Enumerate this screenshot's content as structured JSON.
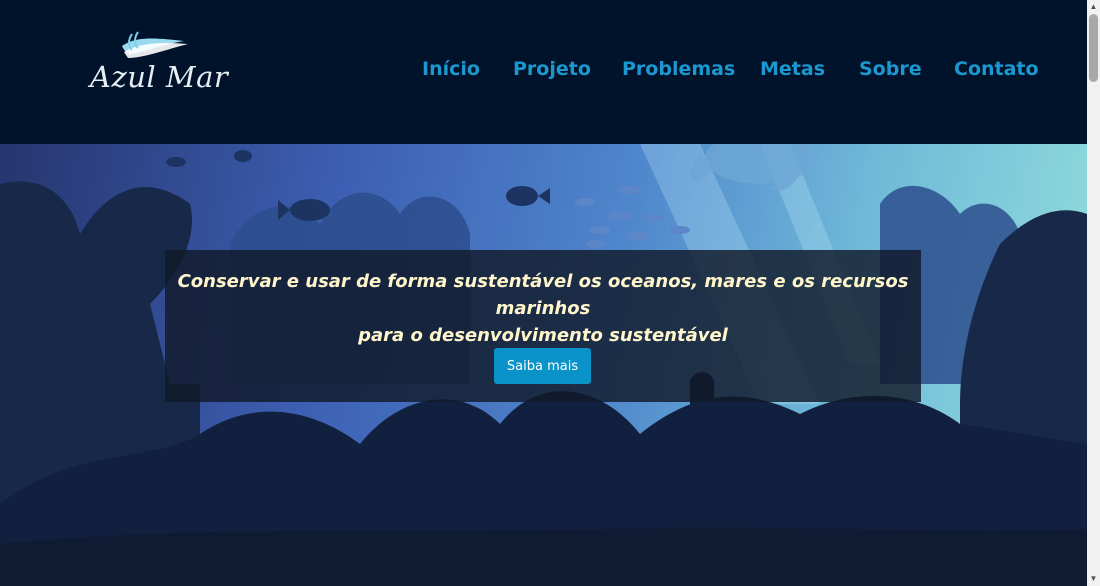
{
  "brand": {
    "name": "Azul Mar",
    "logo_icon": "wave-icon"
  },
  "nav": {
    "items": [
      {
        "label": "Início",
        "id": "inicio"
      },
      {
        "label": "Projeto",
        "id": "projeto"
      },
      {
        "label": "Problemas",
        "id": "problemas"
      },
      {
        "label": "Metas",
        "id": "metas"
      },
      {
        "label": "Sobre",
        "id": "sobre"
      },
      {
        "label": "Contato",
        "id": "contato"
      }
    ]
  },
  "hero": {
    "line1": "Conservar e usar de forma sustentável os oceanos, mares e os recursos marinhos",
    "line2": "para o desenvolvimento sustentável",
    "cta_label": "Saiba mais"
  },
  "colors": {
    "header_bg": "#00132b",
    "nav_link": "#1a98cf",
    "cta_bg": "#0a93c9",
    "banner_text": "#fff6cc"
  }
}
